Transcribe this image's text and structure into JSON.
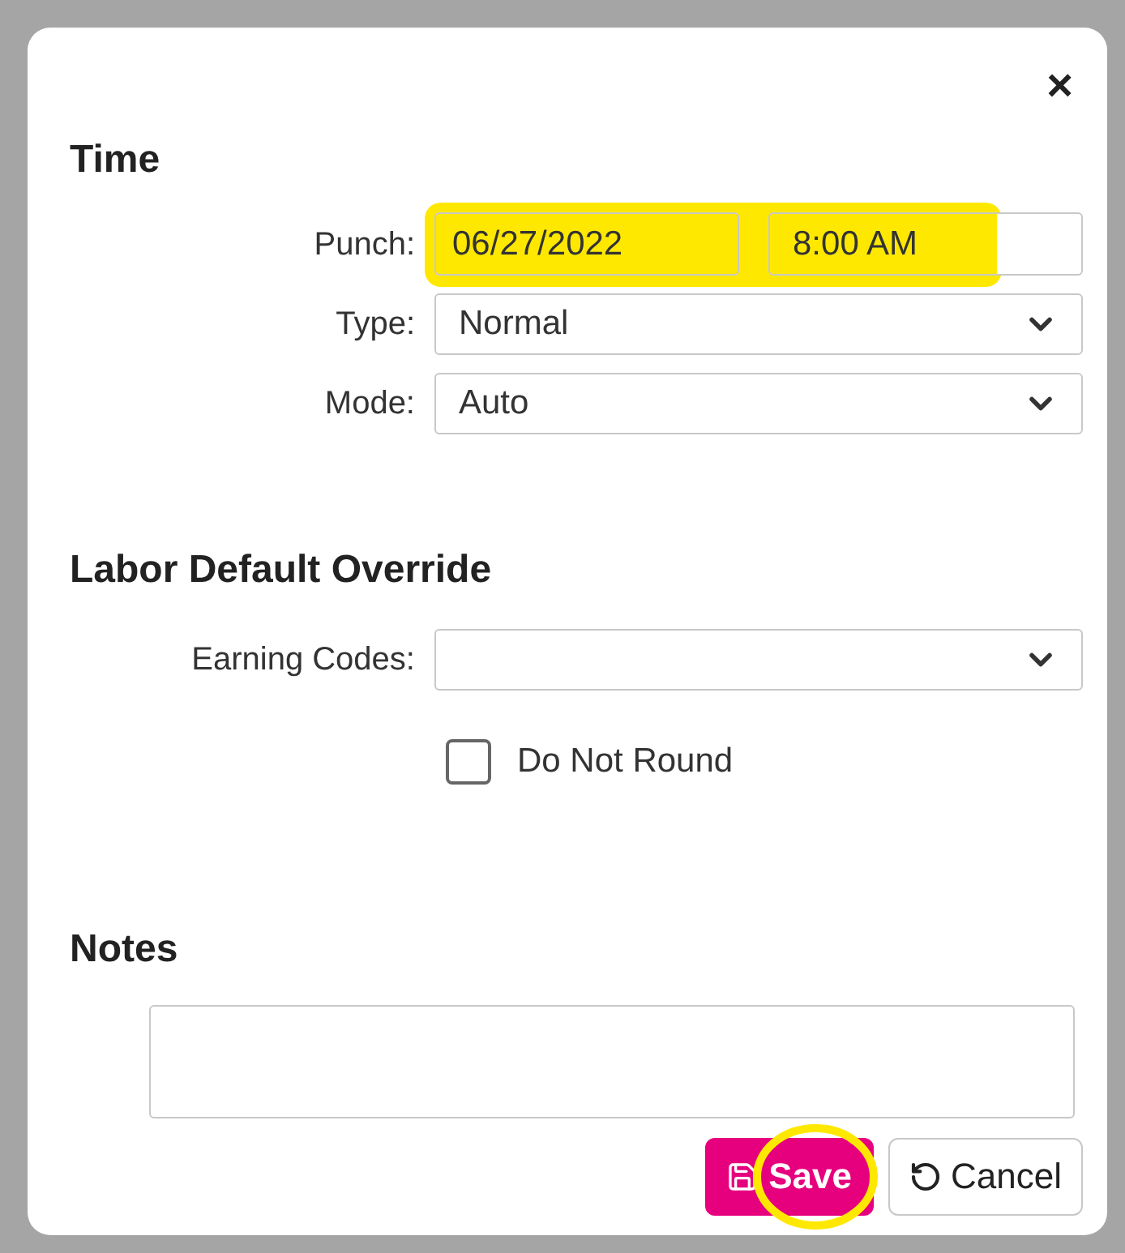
{
  "dialog": {
    "close_label": "×"
  },
  "time": {
    "heading": "Time",
    "punch": {
      "label": "Punch:",
      "date": "06/27/2022",
      "time": "8:00 AM"
    },
    "selects": [
      {
        "label": "Type:",
        "value": "Normal"
      },
      {
        "label": "Mode:",
        "value": "Auto"
      }
    ]
  },
  "labor": {
    "heading": "Labor Default Override",
    "earning_codes": {
      "label": "Earning Codes:"
    },
    "do_not_round": {
      "label": "Do Not Round",
      "checked": false
    }
  },
  "notes": {
    "heading": "Notes"
  },
  "buttons": [
    {
      "kind": "primary",
      "label": "Save"
    },
    {
      "kind": "secondary",
      "label": "Cancel"
    }
  ]
}
